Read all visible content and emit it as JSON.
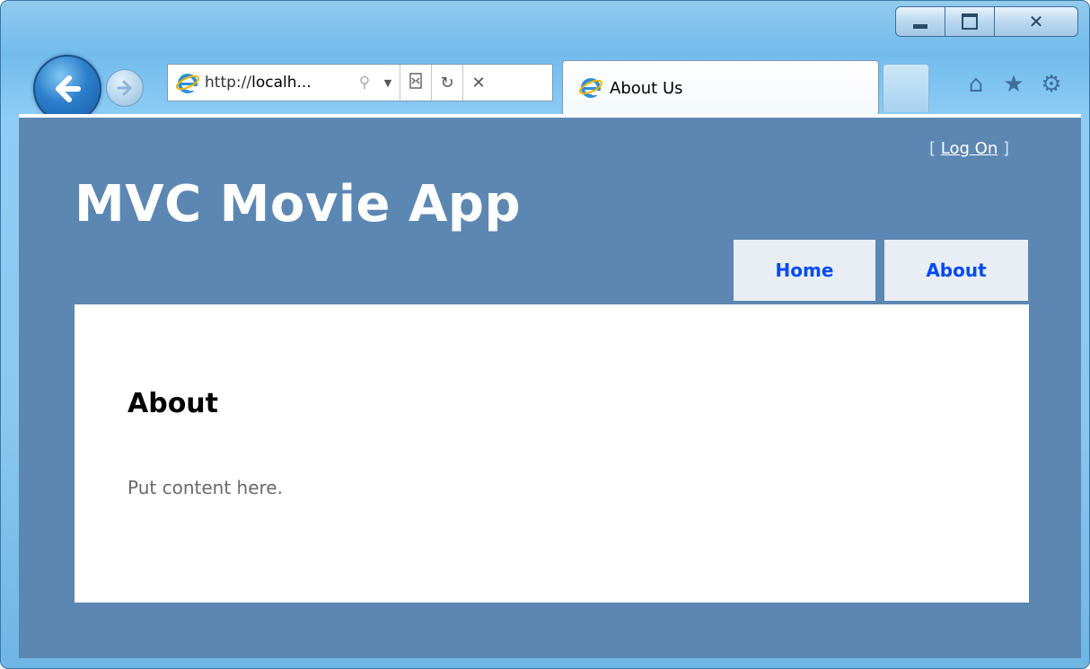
{
  "browser": {
    "address_url_prefix": "http://",
    "address_url_host": "localh...",
    "tab_title": "About Us",
    "icons": {
      "back": "back-arrow-icon",
      "forward": "forward-arrow-icon",
      "search": "search-icon",
      "dropdown": "chevron-down-icon",
      "compat": "compatibility-view-icon",
      "refresh": "refresh-icon",
      "stop": "stop-icon",
      "home": "home-icon",
      "favorites": "star-icon",
      "tools": "gear-icon"
    },
    "caption": {
      "minimize": "minimize-icon",
      "maximize": "maximize-icon",
      "close": "close-icon"
    }
  },
  "page": {
    "login_open": "[ ",
    "login_link": "Log On",
    "login_close": " ]",
    "site_title": "MVC Movie App",
    "menu": [
      {
        "label": "Home"
      },
      {
        "label": "About"
      }
    ],
    "heading": "About",
    "body_text": "Put content here."
  },
  "colors": {
    "page_background": "#5c87b2",
    "menu_link": "#034af3",
    "menu_background": "#e8eef4",
    "body_text": "#696969"
  }
}
